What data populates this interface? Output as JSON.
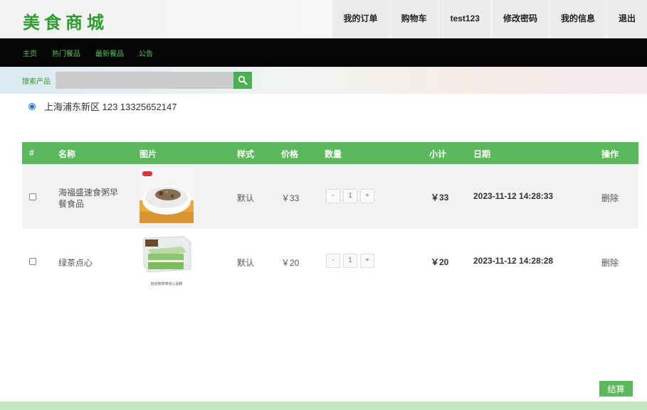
{
  "header": {
    "logo": "美食商城",
    "nav": [
      "我的订单",
      "购物车",
      "test123",
      "修改密码",
      "我的信息",
      "退出"
    ]
  },
  "mainnav": [
    "主页",
    "热门餐品",
    "最新餐品",
    "公告"
  ],
  "search": {
    "label": "搜索产品",
    "value": "",
    "placeholder": ""
  },
  "address": {
    "text": "上海浦东新区 123 13325652147",
    "selected": true
  },
  "table": {
    "headers": [
      "#",
      "名称",
      "图片",
      "样式",
      "价格",
      "数量",
      "小计",
      "日期",
      "操作"
    ],
    "rows": [
      {
        "name": "海福盛速食粥早餐食品",
        "style": "默认",
        "price": "￥33",
        "qty_minus": "-",
        "qty": "1",
        "qty_plus": "+",
        "subtotal": "￥33",
        "date": "2023-11-12 14:28:33",
        "action": "删除",
        "image_icon": "congee-bowl-image"
      },
      {
        "name": "绿茶点心",
        "style": "默认",
        "price": "￥20",
        "qty_minus": "-",
        "qty": "1",
        "qty_plus": "+",
        "subtotal": "￥20",
        "date": "2023-11-12 14:28:28",
        "action": "删除",
        "image_icon": "green-tea-cake-image",
        "image_caption": "自动抹茶味夹心蛋糕"
      }
    ]
  },
  "checkout_label": "结算",
  "colors": {
    "accent": "#5cb85c",
    "brand": "#2e9e2e",
    "nav_bg": "#050505"
  }
}
